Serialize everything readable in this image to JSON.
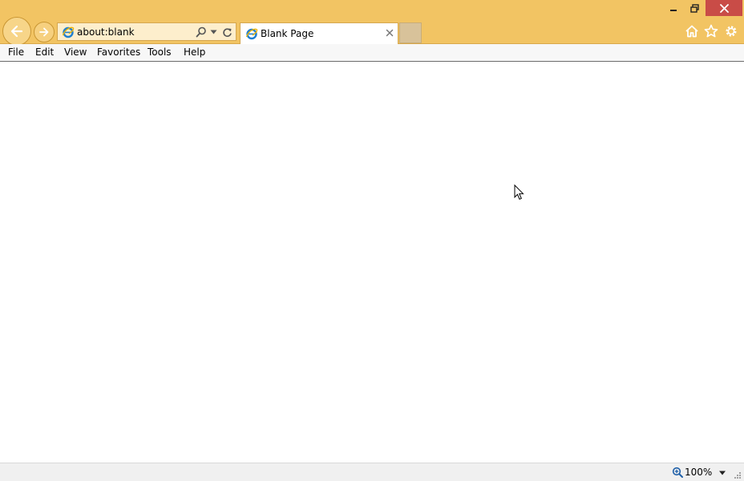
{
  "browser": {
    "address": {
      "value": "about:blank",
      "icon": "ie-icon"
    },
    "tab": {
      "title": "Blank Page",
      "icon": "ie-icon"
    },
    "icons": {
      "back": "back-arrow-icon",
      "forward": "forward-arrow-icon",
      "search": "search-icon",
      "dropdown": "chevron-down-icon",
      "refresh": "refresh-icon",
      "tab_close": "close-icon",
      "home": "home-icon",
      "favorites": "star-icon",
      "settings": "gear-icon",
      "minimize": "minimize-icon",
      "restore": "restore-icon",
      "close": "close-icon"
    },
    "colors": {
      "chrome": "#f2c463",
      "close_button": "#c94c47",
      "new_tab": "#d8c29a"
    }
  },
  "menu": {
    "items": [
      "File",
      "Edit",
      "View",
      "Favorites",
      "Tools",
      "Help"
    ]
  },
  "status": {
    "zoom": "100%"
  }
}
